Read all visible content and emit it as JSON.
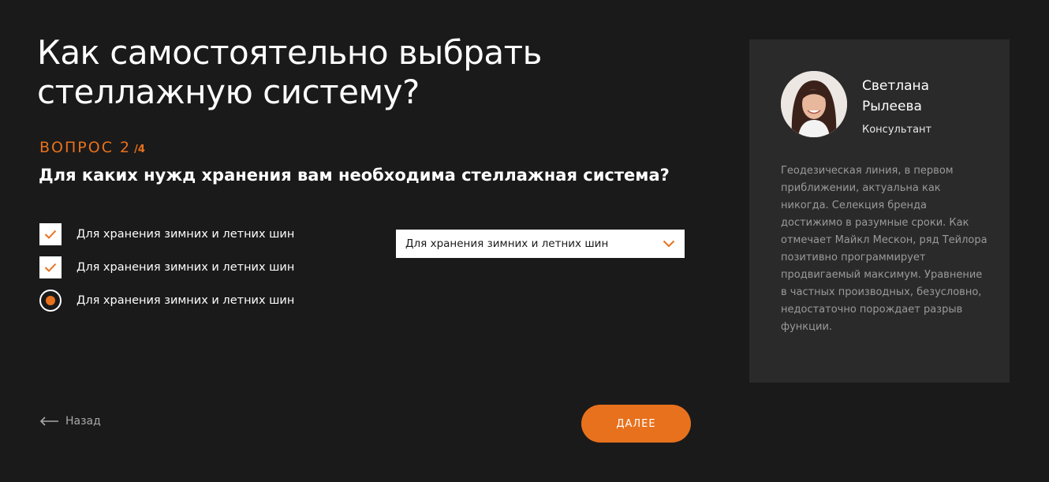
{
  "quiz": {
    "title": "Как самостоятельно выбрать стеллажную систему?",
    "step_label": "ВОПРОС 2",
    "step_total": "/4",
    "question": "Для каких нужд хранения вам необходима стеллажная система?"
  },
  "options": [
    {
      "label": "Для хранения зимних и летних шин",
      "type": "checkbox",
      "checked": true
    },
    {
      "label": "Для хранения зимних и летних шин",
      "type": "checkbox",
      "checked": true
    },
    {
      "label": "Для хранения зимних и летних шин",
      "type": "radio",
      "checked": true
    }
  ],
  "select": {
    "value": "Для хранения зимних и летних шин"
  },
  "nav": {
    "back_label": "Назад",
    "next_label": "ДАЛЕЕ"
  },
  "consultant": {
    "name": "Светлана Рылеева",
    "role": "Консультант",
    "description": "Геодезическая линия, в первом приближении, актуальна как никогда. Селекция бренда достижимо в разумные сроки. Как отмечает Майкл Мескон, ряд Тейлора позитивно программирует продвигаемый максимум. Уравнение в частных производных, безусловно, недостаточно порождает разрыв функции."
  },
  "colors": {
    "accent": "#e8711d",
    "background": "#1b1a1a",
    "panel": "#2b2a2a"
  },
  "icons": {
    "checkbox": "check-icon",
    "dropdown": "chevron-down-icon",
    "back": "arrow-left-icon"
  }
}
